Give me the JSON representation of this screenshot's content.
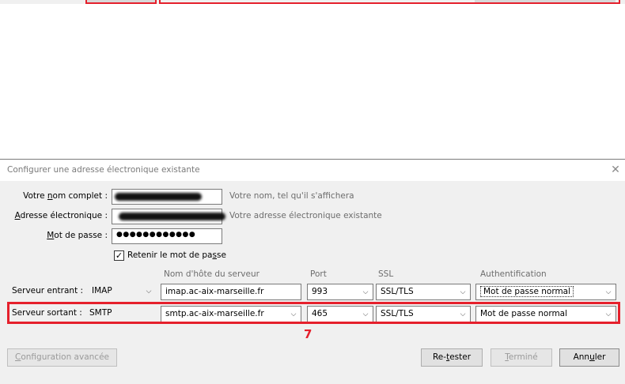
{
  "window_title": "Configurer une adresse électronique existante",
  "icons": {
    "close": "close-icon",
    "checkbox": "checkmark-icon",
    "dropdown": "chevron-down-icon"
  },
  "form": {
    "fullname_label_pre": "Votre ",
    "fullname_label_access": "n",
    "fullname_label_post": "om complet :",
    "fullname_hint": "Votre nom, tel qu'il s'affichera",
    "email_label_access": "A",
    "email_label_post": "dresse électronique :",
    "email_hint": "Votre adresse électronique existante",
    "password_label_access": "M",
    "password_label_post": "ot de passe :",
    "password_value": "●●●●●●●●●●●●",
    "remember_label_pre": "Retenir le mot de pa",
    "remember_label_access": "s",
    "remember_label_post": "se",
    "remember_checked": true
  },
  "columns": {
    "hostname": "Nom d'hôte du serveur",
    "port": "Port",
    "ssl": "SSL",
    "auth": "Authentification"
  },
  "incoming": {
    "label": "Serveur entrant :",
    "protocol": "IMAP",
    "hostname": "imap.ac-aix-marseille.fr",
    "port": "993",
    "ssl": "SSL/TLS",
    "auth": "Mot de passe normal"
  },
  "outgoing": {
    "label": "Serveur sortant :",
    "protocol": "SMTP",
    "hostname": "smtp.ac-aix-marseille.fr",
    "port": "465",
    "ssl": "SSL/TLS",
    "auth": "Mot de passe normal"
  },
  "step_number": "7",
  "buttons": {
    "advanced_access": "C",
    "advanced_post": "onfiguration avancée",
    "retest_pre": "Re-",
    "retest_access": "t",
    "retest_post": "ester",
    "done_access": "T",
    "done_post": "erminé",
    "cancel_pre": "Ann",
    "cancel_access": "u",
    "cancel_post": "ler"
  },
  "colors": {
    "highlight": "#e5202c",
    "dialog_bg": "#f0f0f0"
  }
}
